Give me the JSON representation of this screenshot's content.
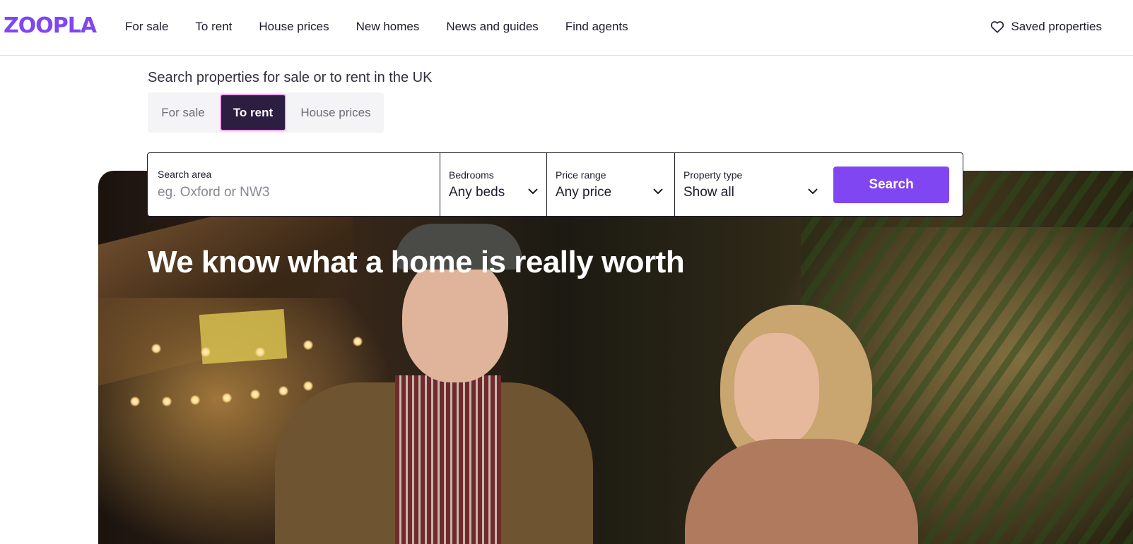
{
  "header": {
    "logo": "ZOOPLA",
    "nav": [
      "For sale",
      "To rent",
      "House prices",
      "New homes",
      "News and guides",
      "Find agents"
    ],
    "saved_label": "Saved properties"
  },
  "search": {
    "intro": "Search properties for sale or to rent in the UK",
    "tabs": [
      {
        "label": "For sale",
        "active": false
      },
      {
        "label": "To rent",
        "active": true
      },
      {
        "label": "House prices",
        "active": false
      }
    ],
    "area_label": "Search area",
    "area_placeholder": "eg. Oxford or NW3",
    "bedrooms_label": "Bedrooms",
    "bedrooms_value": "Any beds",
    "price_label": "Price range",
    "price_value": "Any price",
    "type_label": "Property type",
    "type_value": "Show all",
    "button": "Search"
  },
  "hero": {
    "headline": "We know what a home is really worth"
  },
  "colors": {
    "brand": "#8046f1",
    "active_tab": "#2c1e41",
    "active_tab_border": "#f2a7f0"
  },
  "icons": {
    "saved": "heart-icon",
    "dropdown": "chevron-down-icon"
  }
}
